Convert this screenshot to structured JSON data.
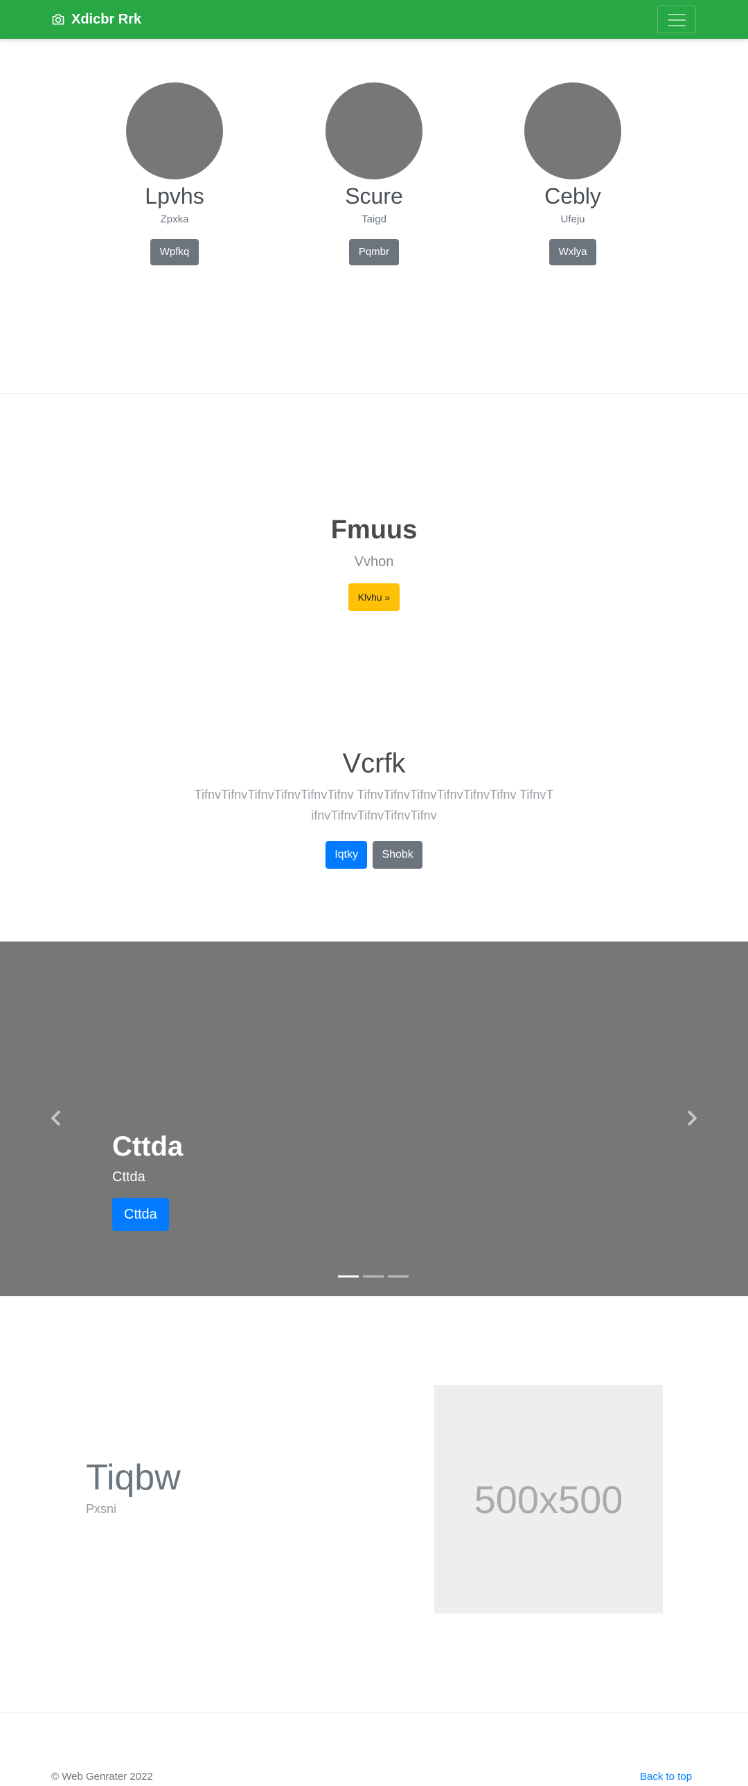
{
  "navbar": {
    "brand": "Xdicbr Rrk",
    "brand_icon": "camera-icon",
    "toggler_icon": "hamburger-icon",
    "color": "#28a745"
  },
  "team": [
    {
      "name": "Lpvhs",
      "role": "Zpxka",
      "button": "Wpfkq"
    },
    {
      "name": "Scure",
      "role": "Taigd",
      "button": "Pqmbr"
    },
    {
      "name": "Cebly",
      "role": "Ufeju",
      "button": "Wxlya"
    }
  ],
  "hero1": {
    "title": "Fmuus",
    "subtitle": "Vvhon",
    "button": "Klvhu »"
  },
  "hero2": {
    "title": "Vcrfk",
    "paragraph": "TifnvTifnvTifnvTifnvTifnvTifnv TifnvTifnvTifnvTifnvTifnvTifnv TifnvTifnvTifnvTifnvTifnvTifnv",
    "primary_button": "Iqtky",
    "secondary_button": "Shobk"
  },
  "carousel": {
    "title": "Cttda",
    "subtitle": "Cttda",
    "button": "Cttda",
    "prev_icon": "chevron-left-icon",
    "next_icon": "chevron-right-icon",
    "slides": 3,
    "active_slide": 1
  },
  "feature": {
    "title": "Tiqbw",
    "subtitle": "Pxsni",
    "image_label": "500x500"
  },
  "footer": {
    "copyright": "© Web Genrater 2022",
    "back_to_top": "Back to top"
  }
}
